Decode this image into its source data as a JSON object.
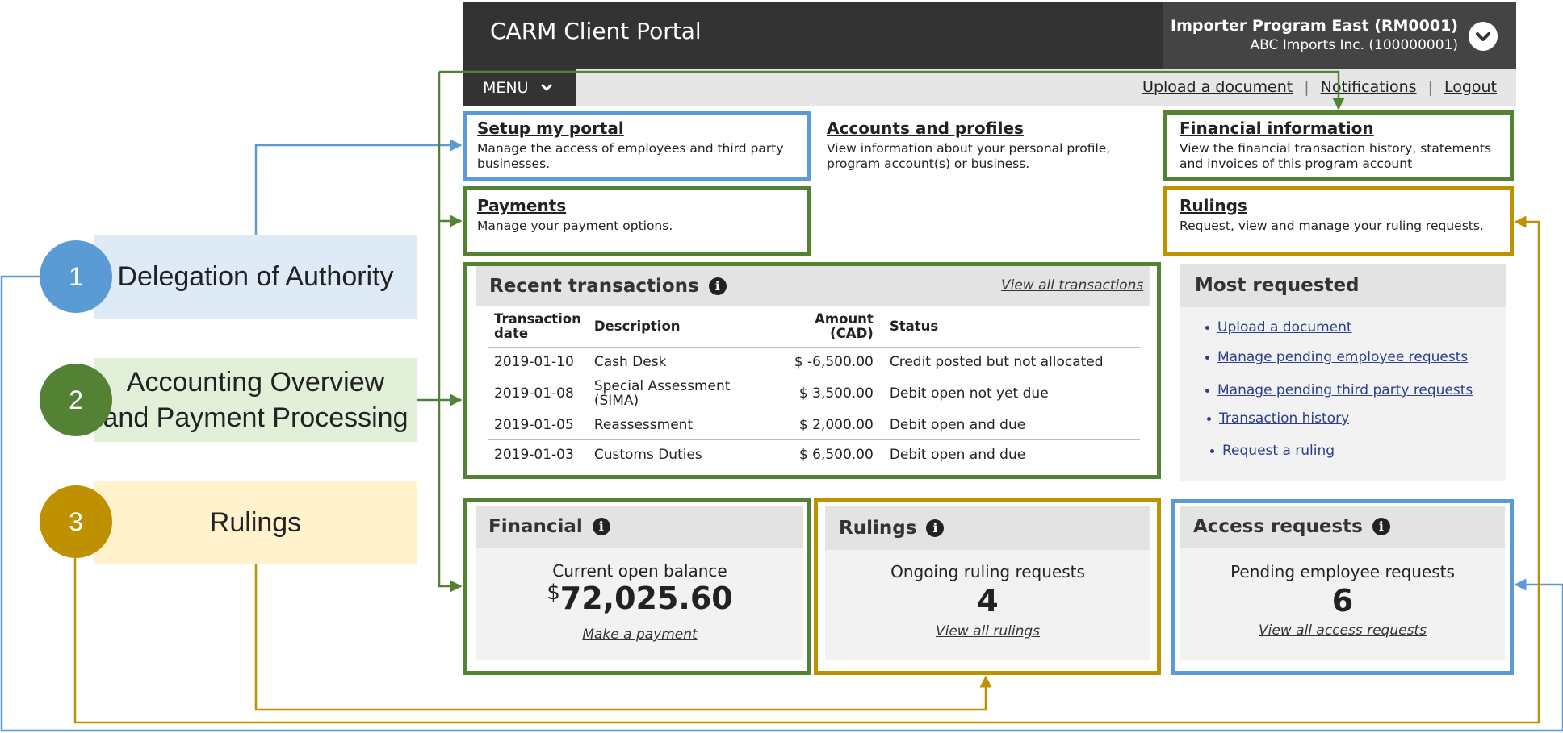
{
  "colors": {
    "blue": "#5b9bd5",
    "green": "#548235",
    "gold": "#bf9000",
    "blue_fill": "#deebf7",
    "green_fill": "#e2f0d9",
    "gold_fill": "#fff2cc",
    "header_bg": "#333333",
    "link_blue": "#2a3e8c"
  },
  "header": {
    "app_title": "CARM Client Portal",
    "account_name": "Importer Program East (RM0001)",
    "account_sub": "ABC Imports Inc. (100000001)",
    "account_toggle_icon": "chevron-down-icon"
  },
  "nav": {
    "menu_label": "MENU",
    "menu_icon": "chevron-down-icon",
    "upload_label": "Upload a document",
    "notifications_label": "Notifications",
    "logout_label": "Logout",
    "separator": "|"
  },
  "quicklinks": {
    "setup": {
      "title": "Setup my portal",
      "desc_1": "Manage the access of employees and third party",
      "desc_2": "businesses."
    },
    "accounts": {
      "title": "Accounts and profiles",
      "desc_1": "View information about your personal profile,",
      "desc_2": "program account(s) or business."
    },
    "financial": {
      "title": "Financial information",
      "desc_1": "View the financial transaction history, statements",
      "desc_2": "and invoices of this program account"
    },
    "payments": {
      "title": "Payments",
      "desc_1": "Manage your payment options."
    },
    "rulings": {
      "title": "Rulings",
      "desc_1": "Request, view and manage your ruling requests."
    }
  },
  "transactions": {
    "title": "Recent transactions",
    "info_icon": "info-icon",
    "view_all": "View all transactions",
    "headers": {
      "date_1": "Transaction",
      "date_2": "date",
      "description": "Description",
      "amount": "Amount (CAD)",
      "status": "Status"
    },
    "rows": [
      {
        "date": "2019-01-10",
        "description_1": "Cash Desk",
        "description_2": "",
        "amount": "$ -6,500.00",
        "status": "Credit posted but not allocated"
      },
      {
        "date": "2019-01-08",
        "description_1": "Special Assessment",
        "description_2": "(SIMA)",
        "amount": "$  3,500.00",
        "status": "Debit open not yet due"
      },
      {
        "date": "2019-01-05",
        "description_1": "Reassessment",
        "description_2": "",
        "amount": "$  2,000.00",
        "status": "Debit open and due"
      },
      {
        "date": "2019-01-03",
        "description_1": "Customs Duties",
        "description_2": "",
        "amount": "$  6,500.00",
        "status": "Debit open and due"
      }
    ]
  },
  "most_requested": {
    "title": "Most requested",
    "links": [
      "Upload a document",
      "Manage pending employee requests",
      "Manage pending third party requests",
      "Transaction history",
      "Request a ruling"
    ]
  },
  "financial": {
    "title": "Financial",
    "label": "Current open balance",
    "currency": "$",
    "balance": "72,025.60",
    "link": "Make a payment"
  },
  "rulings_card": {
    "title": "Rulings",
    "label": "Ongoing ruling requests",
    "count": "4",
    "link": "View all rulings"
  },
  "access": {
    "title": "Access requests",
    "label": "Pending employee requests",
    "count": "6",
    "link": "View all access requests"
  },
  "legend": [
    {
      "number": "1",
      "label_1": "Delegation of Authority",
      "label_2": ""
    },
    {
      "number": "2",
      "label_1": "Accounting Overview",
      "label_2": "and Payment Processing"
    },
    {
      "number": "3",
      "label_1": "Rulings",
      "label_2": ""
    }
  ]
}
